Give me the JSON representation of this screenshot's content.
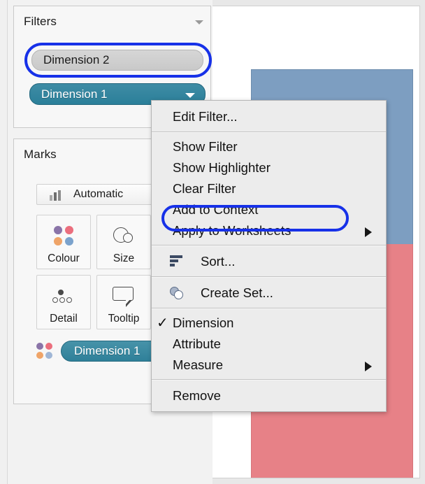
{
  "filters_card": {
    "title": "Filters",
    "caret_icon": "chevron-down-icon",
    "pills": [
      {
        "label": "Dimension 2",
        "state": "selected-grey",
        "annotated": true
      },
      {
        "label": "Dimension 1",
        "state": "active-blue",
        "annotated": false,
        "caret_icon": "chevron-down-icon"
      }
    ]
  },
  "marks_card": {
    "title": "Marks",
    "caret_icon": "chevron-down-icon",
    "mark_type": {
      "label": "Automatic",
      "icon": "bar-chart-icon"
    },
    "buttons": [
      {
        "label": "Colour",
        "icon": "four-colour-dots-icon"
      },
      {
        "label": "Size",
        "icon": "two-circles-icon"
      },
      {
        "label": "Detail",
        "icon": "four-small-circles-icon"
      },
      {
        "label": "Tooltip",
        "icon": "speech-bubble-icon"
      }
    ],
    "pill": {
      "label": "Dimension 1",
      "icon": "four-colour-dots-icon"
    }
  },
  "context_menu": {
    "groups": [
      {
        "items": [
          {
            "label": "Edit Filter...",
            "icon": null,
            "submenu": false,
            "checked": false,
            "highlighted": false
          }
        ]
      },
      {
        "items": [
          {
            "label": "Show Filter",
            "icon": null,
            "submenu": false,
            "checked": false,
            "highlighted": false
          },
          {
            "label": "Show Highlighter",
            "icon": null,
            "submenu": false,
            "checked": false,
            "highlighted": false
          },
          {
            "label": "Clear Filter",
            "icon": null,
            "submenu": false,
            "checked": false,
            "highlighted": false
          },
          {
            "label": "Add to Context",
            "icon": null,
            "submenu": false,
            "checked": false,
            "highlighted": true
          },
          {
            "label": "Apply to Worksheets",
            "icon": null,
            "submenu": true,
            "checked": false,
            "highlighted": false
          }
        ]
      },
      {
        "items": [
          {
            "label": "Sort...",
            "icon": "sort-icon",
            "submenu": false,
            "checked": false,
            "highlighted": false
          }
        ]
      },
      {
        "items": [
          {
            "label": "Create Set...",
            "icon": "create-set-icon",
            "submenu": false,
            "checked": false,
            "highlighted": false
          }
        ]
      },
      {
        "items": [
          {
            "label": "Dimension",
            "icon": null,
            "submenu": false,
            "checked": true,
            "highlighted": false
          },
          {
            "label": "Attribute",
            "icon": null,
            "submenu": false,
            "checked": false,
            "highlighted": false
          },
          {
            "label": "Measure",
            "icon": null,
            "submenu": true,
            "checked": false,
            "highlighted": false
          }
        ]
      },
      {
        "items": [
          {
            "label": "Remove",
            "icon": null,
            "submenu": false,
            "checked": false,
            "highlighted": false
          }
        ]
      }
    ],
    "check_glyph": "✓",
    "submenu_glyph": "▶"
  },
  "viz": {
    "bars": [
      {
        "name": "upper-segment",
        "colour": "#7d9ec1"
      },
      {
        "name": "lower-segment",
        "colour": "#e78187"
      }
    ]
  },
  "annotation": {
    "colour": "#1731e8",
    "targets": [
      "Dimension 2",
      "Add to Context"
    ]
  }
}
